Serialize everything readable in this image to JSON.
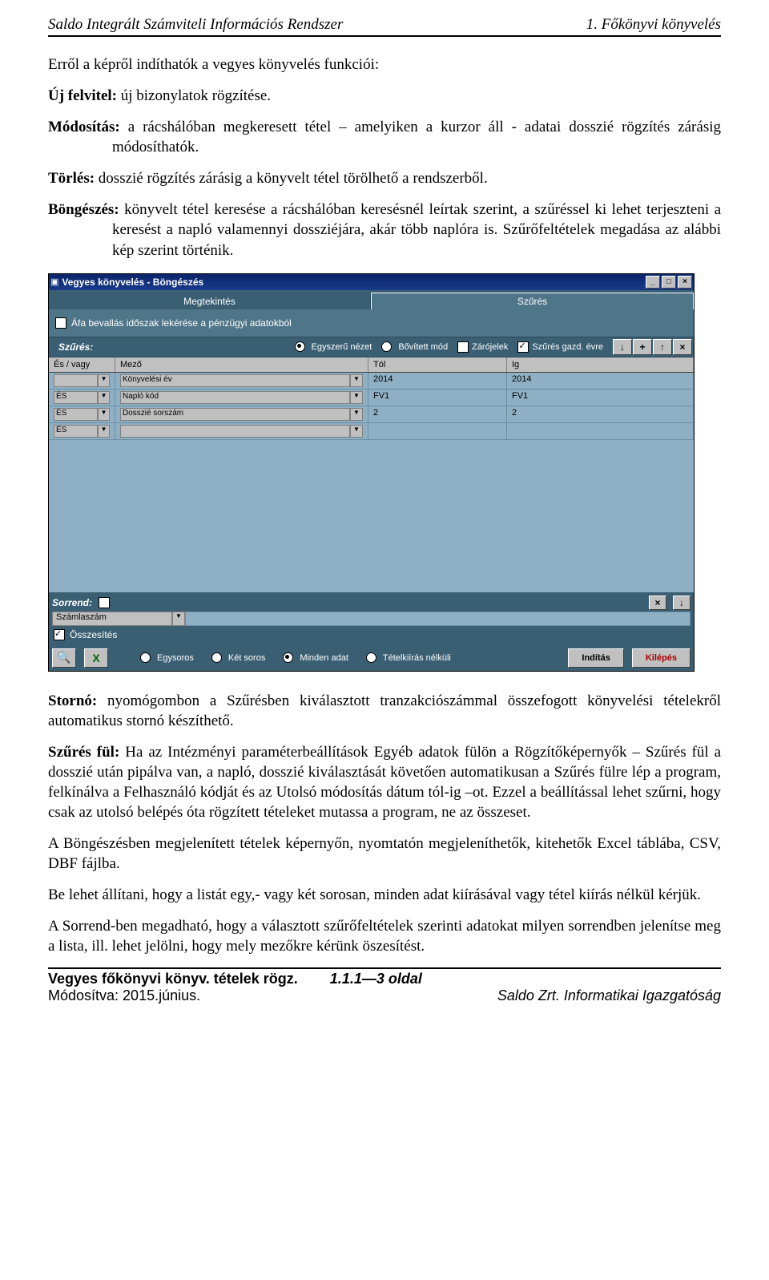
{
  "header": {
    "left": "Saldo Integrált Számviteli Információs Rendszer",
    "right": "1. Főkönyvi könyvelés"
  },
  "paragraphs": {
    "p1": "Erről a képről indíthatók a vegyes könyvelés funkciói:",
    "p2_lead": "Új felvitel:",
    "p2_rest": " új bizonylatok rögzítése.",
    "p3_lead": "Módosítás:",
    "p3_rest": " a rácshálóban  megkeresett tétel – amelyiken a kurzor áll - adatai dosszié rögzítés zárásig módosíthatók.",
    "p4_lead": "Törlés:",
    "p4_rest": " dosszié rögzítés zárásig a könyvelt tétel törölhető a rendszerből.",
    "p5_lead": "Böngészés:",
    "p5_rest": " könyvelt tétel keresése a rácshálóban keresésnél leírtak szerint, a szűréssel ki lehet terjeszteni a keresést a napló valamennyi dossziéjára, akár több naplóra is. Szűrőfeltételek megadása az alábbi kép szerint történik.",
    "p6_lead": "Stornó:",
    "p6_rest": " nyomógombon a Szűrésben kiválasztott tranzakciószámmal összefogott könyvelési tételekről automatikus stornó készíthető.",
    "p7_lead": "Szűrés fül:",
    "p7_rest": " Ha az Intézményi paraméterbeállítások  Egyéb adatok fülön a Rögzítőképernyők – Szűrés fül a dosszié után pipálva van, a napló, dosszié kiválasztását követően automatikusan a Szűrés fülre lép a program, felkínálva a Felhasználó kódját és az Utolsó módosítás dátum tól-ig –ot. Ezzel a beállítással lehet szűrni, hogy csak az utolsó belépés óta rögzített tételeket mutassa a program, ne az összeset.",
    "p8": "A Böngészésben megjelenített tételek képernyőn, nyomtatón megjeleníthetők, kitehetők Excel táblába, CSV, DBF fájlba.",
    "p9": "Be lehet állítani, hogy a listát egy,- vagy két sorosan, minden adat kiírásával vagy tétel kiírás nélkül kérjük.",
    "p10": "A Sorrend-ben megadható, hogy a választott szűrőfeltételek szerinti adatokat milyen sorrendben jelenítse meg a lista, ill. lehet jelölni, hogy mely mezőkre kérünk öszesítést."
  },
  "win": {
    "title": "Vegyes könyvelés - Böngészés",
    "tabs": {
      "t1": "Megtekintés",
      "t2": "Szűrés"
    },
    "check_afa": "Áfa bevallás időszak lekérése a pénzügyi adatokból",
    "filter_label": "Szűrés:",
    "radios": {
      "r1": "Egyszerű nézet",
      "r2": "Bővített mód"
    },
    "cb_zarojel": "Zárójelek",
    "cb_gazd": "Szűrés gazd. évre",
    "fbtns": {
      "b1": "↓",
      "b2": "+",
      "b3": "↑",
      "b4": "×"
    },
    "grid_head": {
      "h1": "És / vagy",
      "h2": "Mező",
      "h3": "Tól",
      "h4": "Ig"
    },
    "rows": [
      {
        "op": "",
        "field": "Könyvelési év",
        "from": "2014",
        "to": "2014"
      },
      {
        "op": "ÉS",
        "field": "Napló kód",
        "from": "FV1",
        "to": "FV1"
      },
      {
        "op": "ÉS",
        "field": "Dosszié sorszám",
        "from": "2",
        "to": "2"
      },
      {
        "op": "ÉS",
        "field": "",
        "from": "",
        "to": ""
      }
    ],
    "sorrend_label": "Sorrend:",
    "sort_field": "Számlaszám",
    "cb_ossz": "Összesítés",
    "bottom_radios": {
      "r1": "Egysoros",
      "r2": "Két soros",
      "r3": "Minden adat",
      "r4": "Tételkiírás nélküli"
    },
    "btn_start": "Indítás",
    "btn_exit": "Kilépés"
  },
  "footer": {
    "l1_left": "Vegyes főkönyvi könyv. tételek rögz.",
    "l1_right": "1.1.1—3 oldal",
    "l2_left": "Módosítva: 2015.június.",
    "l2_right": "Saldo Zrt. Informatikai Igazgatóság"
  }
}
